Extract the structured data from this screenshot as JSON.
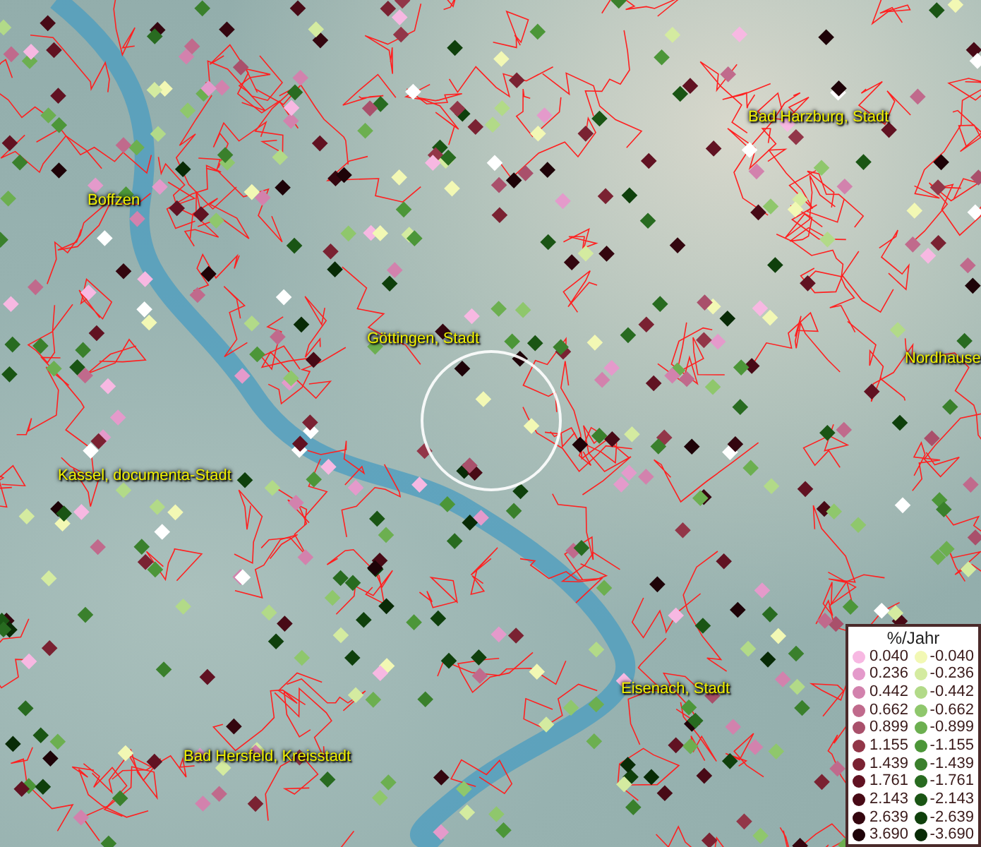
{
  "map": {
    "places": [
      {
        "name": "Bad Harzburg, Stadt"
      },
      {
        "name": "Boffzen"
      },
      {
        "name": "Göttingen, Stadt"
      },
      {
        "name": "Nordhause"
      },
      {
        "name": "Kassel, documenta-Stadt"
      },
      {
        "name": "Eisenach, Stadt"
      },
      {
        "name": "Bad Hersfeld, Kreisstadt"
      }
    ]
  },
  "legend": {
    "title": "%/Jahr",
    "columns": [
      {
        "entries": [
          {
            "value": "0.040",
            "color": "#f7b8e2"
          },
          {
            "value": "0.236",
            "color": "#e49acb"
          },
          {
            "value": "0.442",
            "color": "#d282ad"
          },
          {
            "value": "0.662",
            "color": "#c06a8c"
          },
          {
            "value": "0.899",
            "color": "#a9506b"
          },
          {
            "value": "1.155",
            "color": "#923648"
          },
          {
            "value": "1.439",
            "color": "#7a2232"
          },
          {
            "value": "1.761",
            "color": "#611222"
          },
          {
            "value": "2.143",
            "color": "#480a16"
          },
          {
            "value": "2.639",
            "color": "#34060f"
          },
          {
            "value": "3.690",
            "color": "#1e0308"
          }
        ]
      },
      {
        "entries": [
          {
            "value": "-0.040",
            "color": "#f2f8b4"
          },
          {
            "value": "-0.236",
            "color": "#d4eba0"
          },
          {
            "value": "-0.442",
            "color": "#b2da88"
          },
          {
            "value": "-0.662",
            "color": "#8fc76c"
          },
          {
            "value": "-0.899",
            "color": "#6caf50"
          },
          {
            "value": "-1.155",
            "color": "#4c9638"
          },
          {
            "value": "-1.439",
            "color": "#3a802c"
          },
          {
            "value": "-1.761",
            "color": "#286b20"
          },
          {
            "value": "-2.143",
            "color": "#1a5514"
          },
          {
            "value": "-2.639",
            "color": "#0f400c"
          },
          {
            "value": "-3.690",
            "color": "#082b06"
          }
        ]
      }
    ]
  }
}
